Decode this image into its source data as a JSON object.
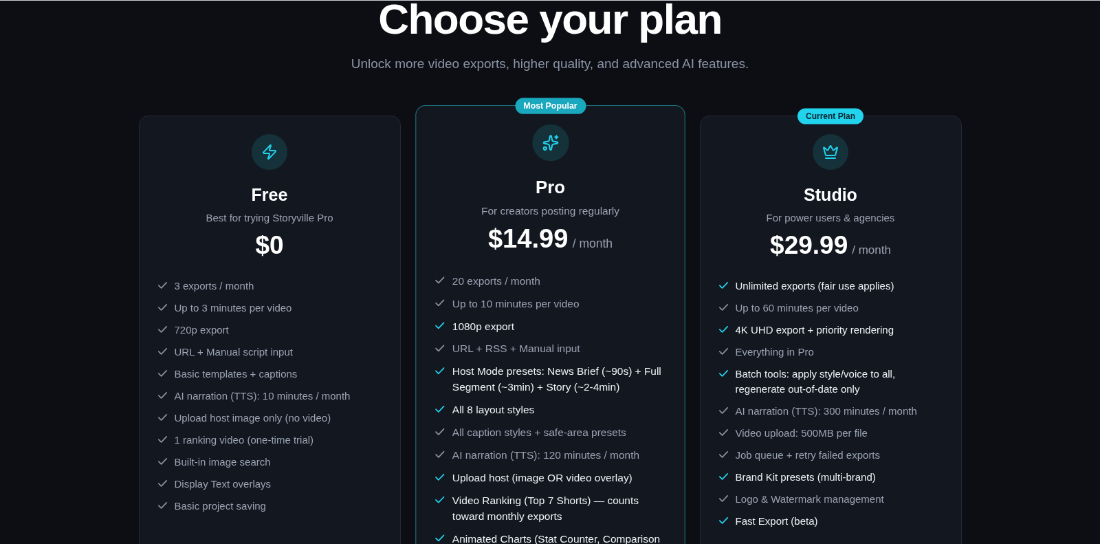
{
  "header": {
    "title": "Choose your plan",
    "subtitle": "Unlock more video exports, higher quality, and advanced AI features."
  },
  "plans": [
    {
      "name": "Free",
      "description": "Best for trying Storyville Pro",
      "price": "$0",
      "featured": false,
      "features": [
        {
          "text": "3 exports / month",
          "highlighted": false
        },
        {
          "text": "Up to 3 minutes per video",
          "highlighted": false
        },
        {
          "text": "720p export",
          "highlighted": false
        },
        {
          "text": "URL + Manual script input",
          "highlighted": false
        },
        {
          "text": "Basic templates + captions",
          "highlighted": false
        },
        {
          "text": "AI narration (TTS): 10 minutes / month",
          "highlighted": false
        },
        {
          "text": "Upload host image only (no video)",
          "highlighted": false
        },
        {
          "text": "1 ranking video (one-time trial)",
          "highlighted": false
        },
        {
          "text": "Built-in image search",
          "highlighted": false
        },
        {
          "text": "Display Text overlays",
          "highlighted": false
        },
        {
          "text": "Basic project saving",
          "highlighted": false
        }
      ]
    },
    {
      "name": "Pro",
      "badge": {
        "kind": "popular",
        "text": "Most Popular"
      },
      "description": "For creators posting regularly",
      "price": "$14.99",
      "period": "/ month",
      "featured": true,
      "features": [
        {
          "text": "20 exports / month",
          "highlighted": false
        },
        {
          "text": "Up to 10 minutes per video",
          "highlighted": false
        },
        {
          "text": "1080p export",
          "highlighted": true
        },
        {
          "text": "URL + RSS + Manual input",
          "highlighted": false
        },
        {
          "text": "Host Mode presets: News Brief (~90s) + Full Segment (~3min) + Story (~2-4min)",
          "highlighted": true
        },
        {
          "text": "All 8 layout styles",
          "highlighted": true
        },
        {
          "text": "All caption styles + safe-area presets",
          "highlighted": false
        },
        {
          "text": "AI narration (TTS): 120 minutes / month",
          "highlighted": false
        },
        {
          "text": "Upload host (image OR video overlay)",
          "highlighted": true
        },
        {
          "text": "Video Ranking (Top 7 Shorts) — counts toward monthly exports",
          "highlighted": true
        },
        {
          "text": "Animated Charts (Stat Counter, Comparison",
          "highlighted": true
        }
      ]
    },
    {
      "name": "Studio",
      "badge": {
        "kind": "current",
        "text": "Current Plan"
      },
      "description": "For power users & agencies",
      "price": "$29.99",
      "period": "/ month",
      "featured": false,
      "features": [
        {
          "text": "Unlimited exports (fair use applies)",
          "highlighted": true
        },
        {
          "text": "Up to 60 minutes per video",
          "highlighted": false
        },
        {
          "text": "4K UHD export + priority rendering",
          "highlighted": true
        },
        {
          "text": "Everything in Pro",
          "highlighted": false
        },
        {
          "text": "Batch tools: apply style/voice to all, regenerate out-of-date only",
          "highlighted": true
        },
        {
          "text": "AI narration (TTS): 300 minutes / month",
          "highlighted": false
        },
        {
          "text": "Video upload: 500MB per file",
          "highlighted": false
        },
        {
          "text": "Job queue + retry failed exports",
          "highlighted": false
        },
        {
          "text": "Brand Kit presets (multi-brand)",
          "highlighted": true
        },
        {
          "text": "Logo & Watermark management",
          "highlighted": false
        },
        {
          "text": "Fast Export (beta)",
          "highlighted": true
        }
      ]
    }
  ]
}
